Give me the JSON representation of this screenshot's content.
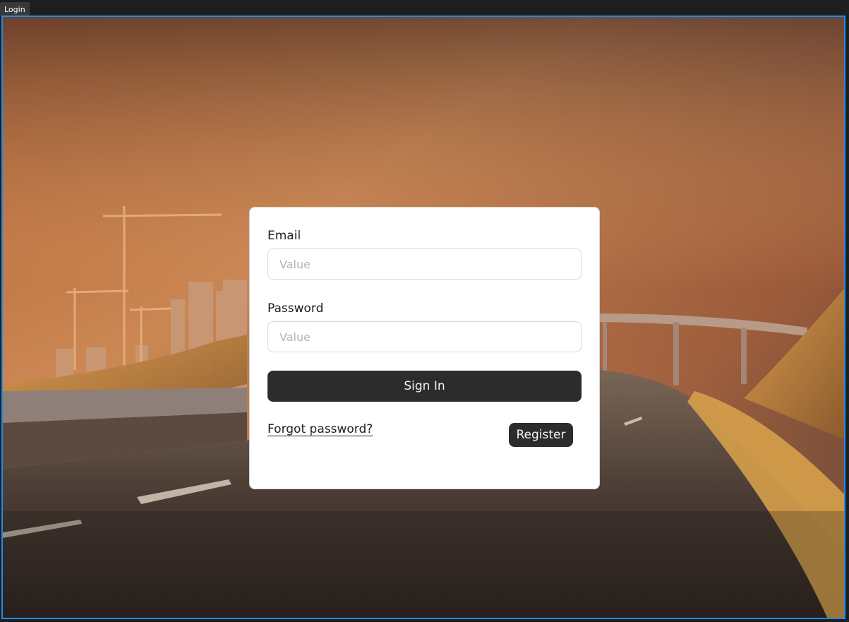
{
  "frame": {
    "label": "Login"
  },
  "background": {
    "description_icon": "highway-photo-background"
  },
  "form": {
    "email": {
      "label": "Email",
      "placeholder": "Value",
      "value": ""
    },
    "password": {
      "label": "Password",
      "placeholder": "Value",
      "value": ""
    },
    "sign_in_label": "Sign In",
    "forgot_password_label": "Forgot password?",
    "register_label": "Register"
  },
  "colors": {
    "frame_border": "#1c8ef0",
    "button_bg": "#2c2c2c",
    "button_text": "#f5f5f5",
    "input_border": "#d9d9d9",
    "placeholder": "#b3b3b3"
  }
}
